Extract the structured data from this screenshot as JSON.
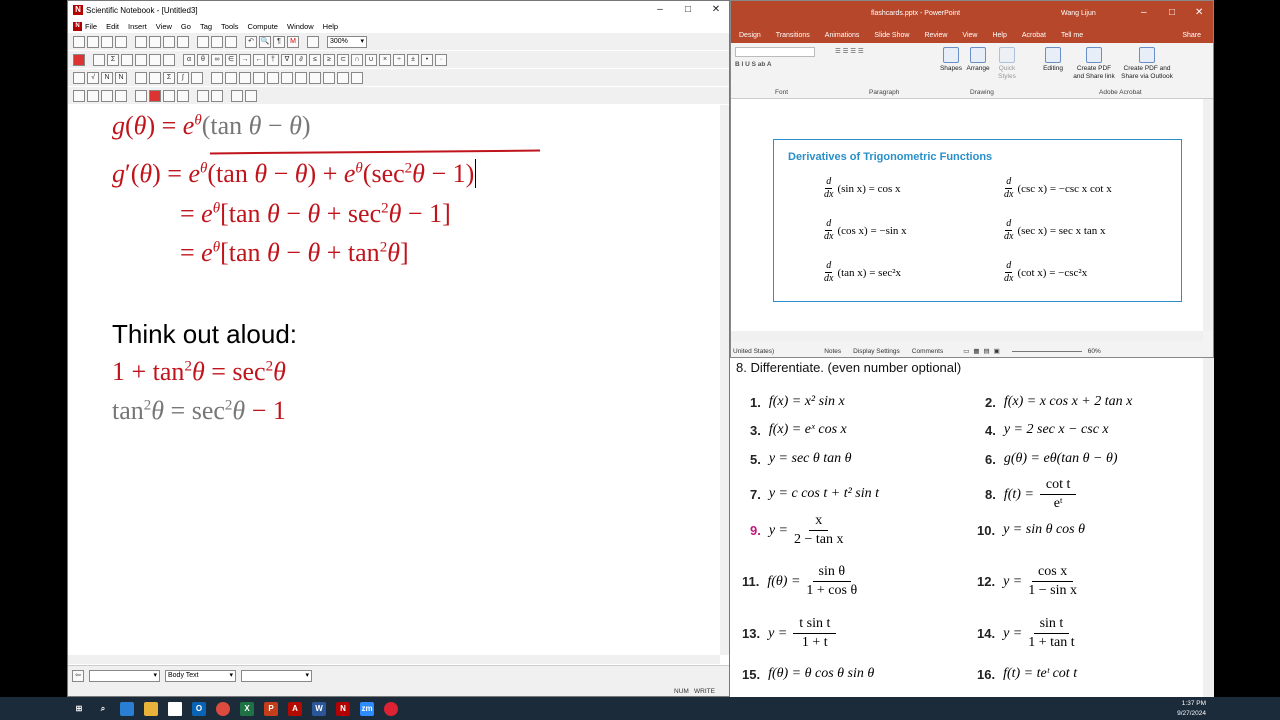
{
  "sn": {
    "title": "Scientific Notebook - [Untitled3]",
    "menu": [
      "File",
      "Edit",
      "Insert",
      "View",
      "Go",
      "Tag",
      "Tools",
      "Compute",
      "Window",
      "Help"
    ],
    "zoom": "300%",
    "status_style": "Body Text",
    "status_right": [
      "NUM",
      "WRITE"
    ],
    "think_text": "Think out aloud:"
  },
  "pp": {
    "title": "flashcards.pptx - PowerPoint",
    "user": "Wang Lijun",
    "tabs": [
      "Design",
      "Transitions",
      "Animations",
      "Slide Show",
      "Review",
      "View",
      "Help",
      "Acrobat",
      "Tell me"
    ],
    "share": "Share",
    "groups": [
      "Font",
      "Paragraph",
      "Drawing",
      "Adobe Acrobat"
    ],
    "buttons": {
      "shapes": "Shapes",
      "arrange": "Arrange",
      "quick_styles": "Quick Styles",
      "editing": "Editing",
      "create_pdf": "Create PDF and Share link",
      "create_pdf_outlook": "Create PDF and Share via Outlook"
    },
    "box_title": "Derivatives of Trigonometric Functions",
    "derivs": [
      {
        "fn": "(sin x) = cos x"
      },
      {
        "fn": "(csc x) = −csc x cot x"
      },
      {
        "fn": "(cos x) = −sin x"
      },
      {
        "fn": "(sec x) = sec x tan x"
      },
      {
        "fn": "(tan x) = sec²x"
      },
      {
        "fn": "(cot x) = −csc²x"
      }
    ],
    "status": {
      "lang": "United States)",
      "notes": "Notes",
      "display": "Display Settings",
      "comments": "Comments",
      "zoom": "60%"
    }
  },
  "book": {
    "heading": "8.  Differentiate. (even number optional)",
    "problems": [
      {
        "n": "1.",
        "expr": "f(x) = x² sin x"
      },
      {
        "n": "2.",
        "expr": "f(x) = x cos x + 2 tan x"
      },
      {
        "n": "3.",
        "expr": "f(x) = eˣ cos x"
      },
      {
        "n": "4.",
        "expr": "y = 2 sec x − csc x"
      },
      {
        "n": "5.",
        "expr": "y = sec θ  tan θ"
      },
      {
        "n": "6.",
        "expr": "g(θ) = eθ(tan θ − θ)"
      },
      {
        "n": "7.",
        "expr": "y = c cos t + t² sin t"
      },
      {
        "n": "8.",
        "lhs": "f(t) =",
        "num": "cot t",
        "den": "eᵗ"
      },
      {
        "n": "9.",
        "lhs": "y =",
        "num": "x",
        "den": "2 − tan x"
      },
      {
        "n": "10.",
        "expr": "y = sin θ cos θ"
      },
      {
        "n": "11.",
        "lhs": "f(θ) =",
        "num": "sin θ",
        "den": "1 + cos θ"
      },
      {
        "n": "12.",
        "lhs": "y =",
        "num": "cos x",
        "den": "1 − sin x"
      },
      {
        "n": "13.",
        "lhs": "y =",
        "num": "t sin t",
        "den": "1 + t"
      },
      {
        "n": "14.",
        "lhs": "y =",
        "num": "sin t",
        "den": "1 + tan t"
      },
      {
        "n": "15.",
        "expr": "f(θ) = θ cos θ sin θ"
      },
      {
        "n": "16.",
        "expr": "f(t) = teᵗ cot t"
      }
    ]
  },
  "clock": {
    "time": "1:37 PM",
    "date": "9/27/2024"
  },
  "colors": {
    "red": "#c0141c",
    "ppt": "#b7472a",
    "accent": "#2a8fc9",
    "magenta": "#c2187d"
  }
}
